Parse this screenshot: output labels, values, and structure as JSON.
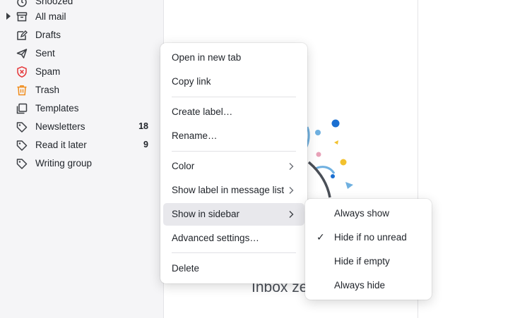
{
  "sidebar": {
    "items": [
      {
        "label": "Snoozed",
        "icon": "snooze-icon",
        "count": ""
      },
      {
        "label": "All mail",
        "icon": "archive-icon",
        "count": ""
      },
      {
        "label": "Drafts",
        "icon": "drafts-icon",
        "count": ""
      },
      {
        "label": "Sent",
        "icon": "send-icon",
        "count": ""
      },
      {
        "label": "Spam",
        "icon": "spam-icon",
        "count": ""
      },
      {
        "label": "Trash",
        "icon": "trash-icon",
        "count": ""
      },
      {
        "label": "Templates",
        "icon": "templates-icon",
        "count": ""
      },
      {
        "label": "Newsletters",
        "icon": "label-icon",
        "count": "18"
      },
      {
        "label": "Read it later",
        "icon": "label-icon",
        "count": "9"
      },
      {
        "label": "Writing group",
        "icon": "label-icon",
        "count": ""
      }
    ]
  },
  "context_menu": {
    "open_new_tab": "Open in new tab",
    "copy_link": "Copy link",
    "create_label": "Create label…",
    "rename": "Rename…",
    "color": "Color",
    "show_label_in_list": "Show label in message list",
    "show_in_sidebar": "Show in sidebar",
    "advanced_settings": "Advanced settings…",
    "delete": "Delete"
  },
  "submenu": {
    "always_show": "Always show",
    "hide_if_no_unread": "Hide if no unread",
    "hide_if_empty": "Hide if empty",
    "always_hide": "Always hide",
    "selected": "Hide if no unread",
    "check_glyph": "✓"
  },
  "main": {
    "empty_state_title": "Inbox ze"
  },
  "colors": {
    "spam": "#e5383b",
    "trash": "#f08c1a",
    "sidebar_bg": "#f5f5f7",
    "menu_highlight": "#e8e8ec"
  }
}
